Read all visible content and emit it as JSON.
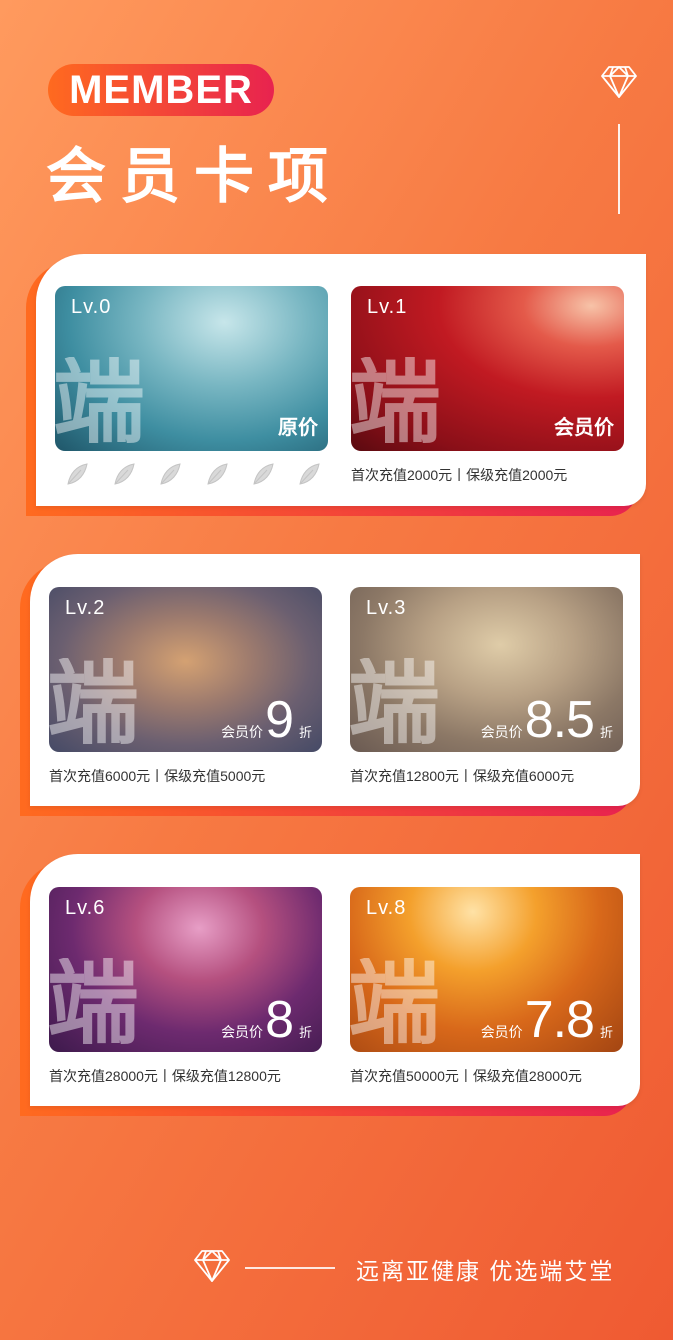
{
  "header": {
    "badge": "MEMBER",
    "title": "会员卡项"
  },
  "cards": [
    {
      "level": "Lv.0",
      "watermark": "端",
      "price_label": "原价",
      "condition": ""
    },
    {
      "level": "Lv.1",
      "watermark": "端",
      "price_label": "会员价",
      "condition": "首次充值2000元丨保级充值2000元"
    },
    {
      "level": "Lv.2",
      "watermark": "端",
      "price_label": "会员价",
      "discount": "9",
      "discount_unit": "折",
      "condition": "首次充值6000元丨保级充值5000元"
    },
    {
      "level": "Lv.3",
      "watermark": "端",
      "price_label": "会员价",
      "discount": "8.5",
      "discount_unit": "折",
      "condition": "首次充值12800元丨保级充值6000元"
    },
    {
      "level": "Lv.6",
      "watermark": "端",
      "price_label": "会员价",
      "discount": "8",
      "discount_unit": "折",
      "condition": "首次充值28000元丨保级充值12800元"
    },
    {
      "level": "Lv.8",
      "watermark": "端",
      "price_label": "会员价",
      "discount": "7.8",
      "discount_unit": "折",
      "condition": "首次充值50000元丨保级充值28000元"
    }
  ],
  "leaves": [
    "leaf-icon",
    "leaf-icon",
    "leaf-icon",
    "leaf-icon",
    "leaf-icon",
    "leaf-icon"
  ],
  "footer": {
    "slogan": "远离亚健康 优选端艾堂"
  },
  "colors": {
    "background_start": "#ff9a5e",
    "background_end": "#ef5a32",
    "badge_start": "#ff6a1f",
    "badge_end": "#e8234f",
    "panel_shadow_start": "#ff6a1f",
    "panel_shadow_end": "#e8234f"
  }
}
